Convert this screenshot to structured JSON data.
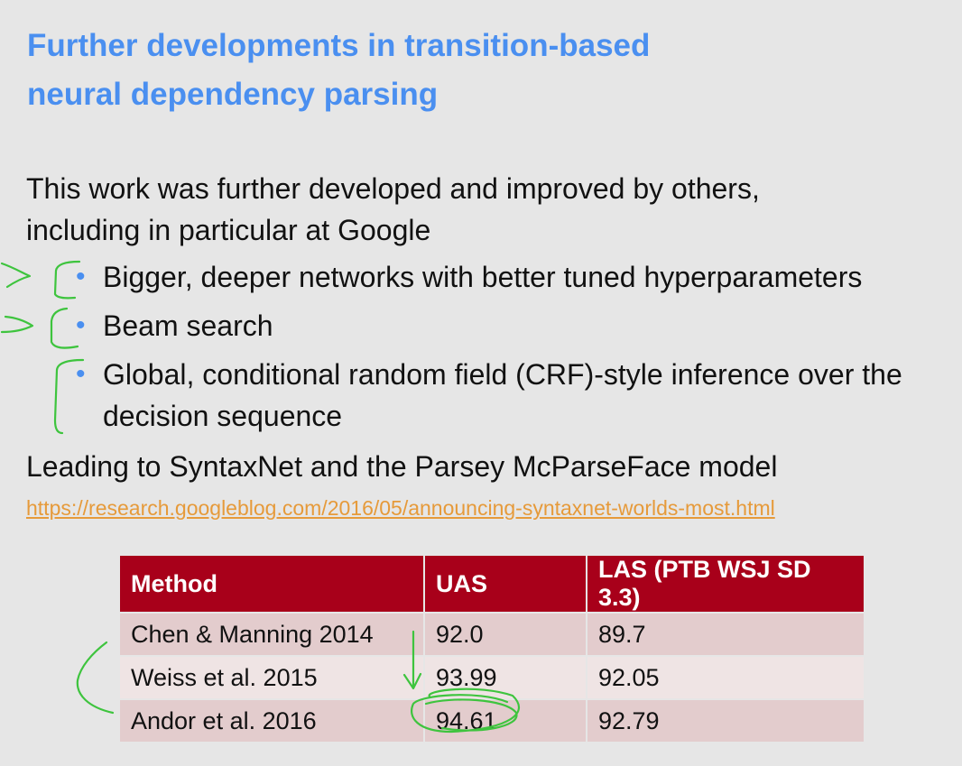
{
  "title": {
    "line1": "Further developments in transition-based",
    "line2": "neural dependency parsing"
  },
  "intro": {
    "line1": "This work was further developed and improved by others,",
    "line2": "including in particular at Google"
  },
  "bullets": [
    "Bigger, deeper networks with better tuned hyperparameters",
    "Beam search",
    "Global, conditional random field (CRF)-style inference over the decision sequence"
  ],
  "leading": "Leading to SyntaxNet and the Parsey McParseFace model",
  "link": "https://research.googleblog.com/2016/05/announcing-syntaxnet-worlds-most.html",
  "table": {
    "headers": [
      "Method",
      "UAS",
      "LAS (PTB WSJ SD 3.3)"
    ],
    "rows": [
      [
        "Chen & Manning 2014",
        "92.0",
        "89.7"
      ],
      [
        "Weiss et al. 2015",
        "93.99",
        "92.05"
      ],
      [
        "Andor et al. 2016",
        "94.61",
        "92.79"
      ]
    ]
  },
  "colors": {
    "title": "#4a8ff0",
    "link": "#e69a3a",
    "table_header": "#a8001a",
    "annotation_ink": "#3ec43e"
  }
}
